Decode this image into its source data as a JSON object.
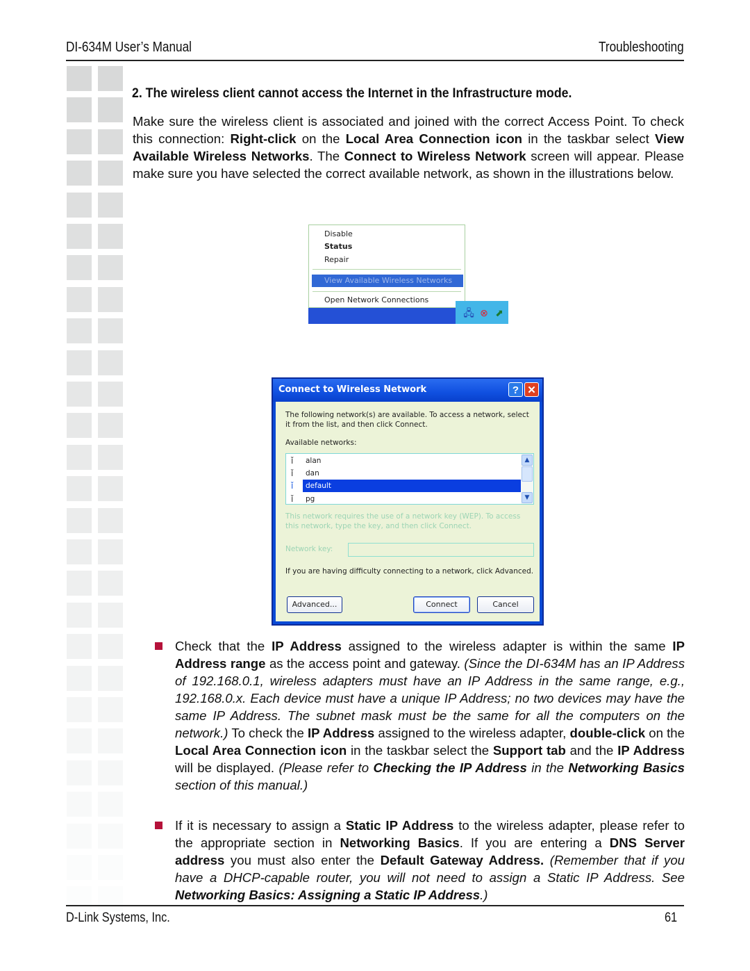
{
  "header": {
    "manual_title": "DI-634M User’s Manual",
    "section": "Troubleshooting"
  },
  "heading": "2. The wireless client cannot access the Internet in the Infrastructure mode.",
  "intro": {
    "t1": "Make sure the wireless client is associated and joined with the correct Access Point. To check this connection: ",
    "b1": "Right-click",
    "t2": " on the ",
    "b2": "Local Area Connection icon",
    "t3": " in the taskbar select ",
    "b3": "View Available Wireless Networks",
    "t4": ". The ",
    "b4": "Connect to Wireless Network",
    "t5": " screen will appear.  Please make sure you have selected the correct available network, as shown in the illustrations below."
  },
  "context_menu": {
    "items": [
      "Disable",
      "Status",
      "Repair",
      "View Available Wireless Networks",
      "Open Network Connections"
    ],
    "highlighted": "View Available Wireless Networks",
    "tray_icons": [
      "network-computers-icon",
      "network-disconnected-icon",
      "wireless-adapter-icon"
    ]
  },
  "dialog": {
    "title": "Connect to Wireless Network",
    "help_label": "?",
    "close_label": "✕",
    "description": "The following network(s) are available. To access a network, select it from the list, and then click Connect.",
    "available_label": "Available networks:",
    "networks": [
      "alan",
      "dan",
      "default",
      "pg"
    ],
    "selected_network": "default",
    "wep_note": "This network requires the use of a network key (WEP). To access this network, type the key, and then click Connect.",
    "key_label": "Network key:",
    "key_value": "",
    "difficulty_text": "If you are having difficulty connecting to a network, click Advanced.",
    "buttons": {
      "advanced": "Advanced...",
      "connect": "Connect",
      "cancel": "Cancel"
    }
  },
  "bullet1": {
    "t1": "Check that the ",
    "b1": "IP Address",
    "t2": " assigned to the wireless adapter is within the same ",
    "b2": "IP Address range",
    "t3": " as the access point and gateway. ",
    "i1": "(Since the  DI-634M has an IP Address of 192.168.0.1, wireless adapters must have an IP Address in the same range, e.g., 192.168.0.x.  Each device must have a unique IP Address; no two devices may have the same IP Address. The subnet mask must be the same for all the computers on the network.)",
    "t4": " To check the ",
    "b3": "IP Address",
    "t5": " assigned to the wireless adapter, ",
    "b4": "double-click",
    "t6": " on the ",
    "b5": "Local Area Connection icon",
    "t7": " in the taskbar  select the ",
    "b6": "Support tab",
    "t8": " and the ",
    "b7": "IP Address",
    "t9": " will be displayed. ",
    "i2": "(Please refer to ",
    "ib1": "Checking the IP Address",
    "i3": " in the ",
    "ib2": "Networking Basics",
    "i4": " section of this manual.)"
  },
  "bullet2": {
    "t1": "If it is necessary to assign a ",
    "b1": "Static IP Address",
    "t2": " to the wireless adapter, please refer to the appropriate section in ",
    "b2": "Networking Basics",
    "t3": ". If you are entering a ",
    "b3": "DNS Server address",
    "t4": " you must also enter the ",
    "b4": "Default Gateway Address.",
    "i1": " (Remember that if you have a DHCP-capable router, you will not need to assign a Static IP Address.  See  ",
    "ib1": "Networking Basics: Assigning a Static IP Address",
    "i2": ".)"
  },
  "footer": {
    "company": "D-Link Systems, Inc.",
    "page_number": "61"
  },
  "colors": {
    "bullet": "#b5123a",
    "selection": "#0a3ee0",
    "xp_title": "#0a4ad6"
  }
}
